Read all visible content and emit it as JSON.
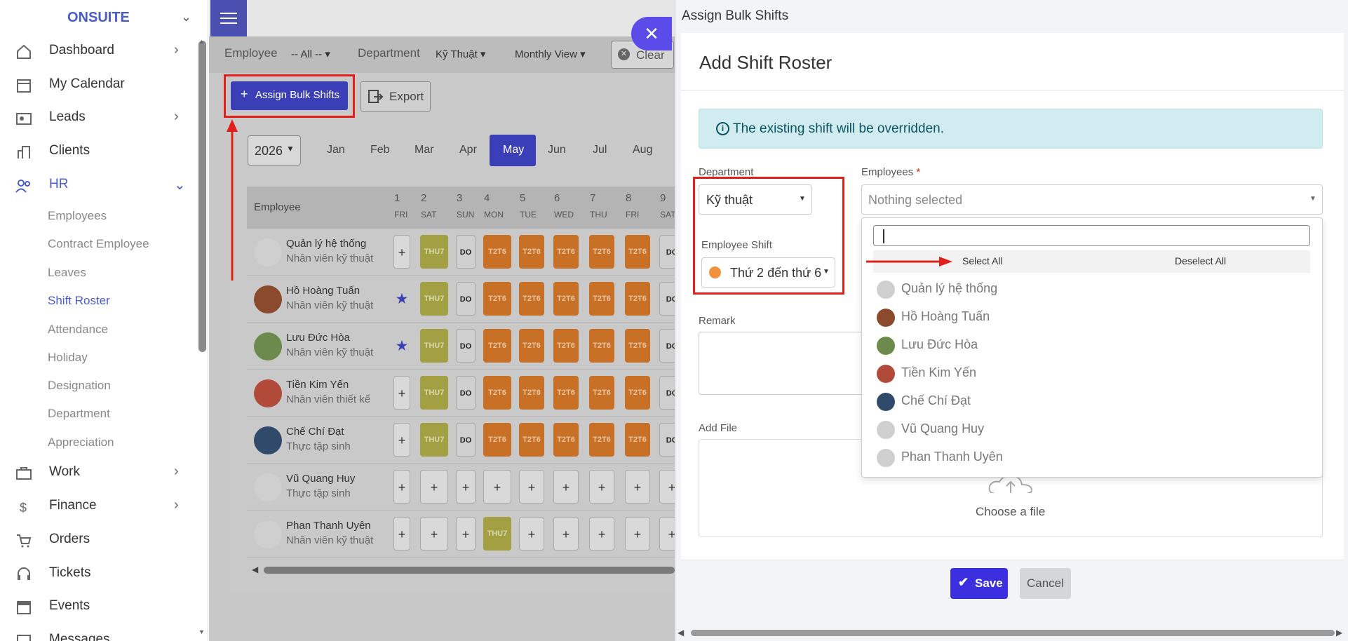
{
  "sidebar": {
    "brand": "ONSUITE",
    "items": [
      {
        "label": "Dashboard",
        "icon": "home-icon",
        "has_chevron": true
      },
      {
        "label": "My Calendar",
        "icon": "calendar-icon",
        "has_chevron": false
      },
      {
        "label": "Leads",
        "icon": "id-card-icon",
        "has_chevron": true
      },
      {
        "label": "Clients",
        "icon": "building-icon",
        "has_chevron": false
      },
      {
        "label": "HR",
        "icon": "users-icon",
        "has_chevron": true,
        "expanded": true
      },
      {
        "label": "Work",
        "icon": "briefcase-icon",
        "has_chevron": true
      },
      {
        "label": "Finance",
        "icon": "dollar-icon",
        "has_chevron": true
      },
      {
        "label": "Orders",
        "icon": "cart-icon",
        "has_chevron": false
      },
      {
        "label": "Tickets",
        "icon": "headset-icon",
        "has_chevron": false
      },
      {
        "label": "Events",
        "icon": "event-calendar-icon",
        "has_chevron": false
      },
      {
        "label": "Messages",
        "icon": "message-icon",
        "has_chevron": false
      }
    ],
    "hr_subitems": [
      "Employees",
      "Contract Employee",
      "Leaves",
      "Shift Roster",
      "Attendance",
      "Holiday",
      "Designation",
      "Department",
      "Appreciation"
    ],
    "active_subitem": "Shift Roster"
  },
  "filters": {
    "employee_label": "Employee",
    "employee_value": "-- All --",
    "department_label": "Department",
    "department_value": "Kỹ Thuật",
    "view_value": "Monthly View",
    "clear_label": "Clear"
  },
  "roster": {
    "assign_button": "Assign Bulk Shifts",
    "export_button": "Export",
    "year": "2026",
    "months": [
      "Jan",
      "Feb",
      "Mar",
      "Apr",
      "May",
      "Jun",
      "Jul",
      "Aug"
    ],
    "active_month": "May",
    "column_header": "Employee",
    "days": [
      {
        "num": "1",
        "dow": "FRI"
      },
      {
        "num": "2",
        "dow": "SAT"
      },
      {
        "num": "3",
        "dow": "SUN"
      },
      {
        "num": "4",
        "dow": "MON"
      },
      {
        "num": "5",
        "dow": "TUE"
      },
      {
        "num": "6",
        "dow": "WED"
      },
      {
        "num": "7",
        "dow": "THU"
      },
      {
        "num": "8",
        "dow": "FRI"
      },
      {
        "num": "9",
        "dow": "SAT"
      }
    ],
    "rows": [
      {
        "name": "Quản lý hệ thống",
        "role": "Nhân viên kỹ thuật",
        "star": false,
        "cells": [
          "+",
          "THU7",
          "DO",
          "T2T6",
          "T2T6",
          "T2T6",
          "T2T6",
          "T2T6",
          "DO"
        ]
      },
      {
        "name": "Hồ Hoàng Tuấn",
        "role": "Nhân viên kỹ thuật",
        "star": true,
        "cells": [
          "star",
          "THU7",
          "DO",
          "T2T6",
          "T2T6",
          "T2T6",
          "T2T6",
          "T2T6",
          "DO"
        ]
      },
      {
        "name": "Lưu Đức Hòa",
        "role": "Nhân viên kỹ thuật",
        "star": true,
        "cells": [
          "star",
          "THU7",
          "DO",
          "T2T6",
          "T2T6",
          "T2T6",
          "T2T6",
          "T2T6",
          "DO"
        ]
      },
      {
        "name": "Tiền Kim Yến",
        "role": "Nhân viên thiết kế",
        "star": false,
        "cells": [
          "+",
          "THU7",
          "DO",
          "T2T6",
          "T2T6",
          "T2T6",
          "T2T6",
          "T2T6",
          "DO"
        ]
      },
      {
        "name": "Chế Chí Đạt",
        "role": "Thực tập sinh",
        "star": false,
        "cells": [
          "+",
          "THU7",
          "DO",
          "T2T6",
          "T2T6",
          "T2T6",
          "T2T6",
          "T2T6",
          "DO"
        ]
      },
      {
        "name": "Vũ Quang Huy",
        "role": "Thực tập sinh",
        "star": false,
        "cells": [
          "+",
          "+",
          "+",
          "+",
          "+",
          "+",
          "+",
          "+",
          "+"
        ]
      },
      {
        "name": "Phan Thanh Uyên",
        "role": "Nhân viên kỹ thuật",
        "star": false,
        "cells": [
          "+",
          "+",
          "+",
          "THU7",
          "+",
          "+",
          "+",
          "+",
          "+"
        ]
      }
    ]
  },
  "drawer": {
    "title": "Assign Bulk Shifts",
    "close_icon": "close-icon",
    "card_title": "Add Shift Roster",
    "alert_text": "The existing shift will be overridden.",
    "department_label": "Department",
    "department_value": "Kỹ thuật",
    "employee_shift_label": "Employee Shift",
    "employee_shift_value": "Thứ 2 đến thứ 6",
    "employee_shift_color": "#f0923b",
    "employees_label": "Employees",
    "required_mark": "*",
    "employees_placeholder": "Nothing selected",
    "remark_label": "Remark",
    "add_file_label": "Add File",
    "choose_file": "Choose a file",
    "save_button": "Save",
    "cancel_button": "Cancel"
  },
  "dropdown": {
    "select_all": "Select All",
    "deselect_all": "Deselect All",
    "options": [
      "Quản lý hệ thống",
      "Hồ Hoàng Tuấn",
      "Lưu Đức Hòa",
      "Tiền Kim Yến",
      "Chế Chí Đạt",
      "Vũ Quang Huy",
      "Phan Thanh Uyên"
    ]
  },
  "colors": {
    "accent": "#3b2fe0",
    "brand": "#4a5cc7",
    "annotation_red": "#e0201b",
    "shift_thu7": "#a3a043",
    "shift_t2t6": "#c87126",
    "alert_bg": "#d1ecf1"
  }
}
